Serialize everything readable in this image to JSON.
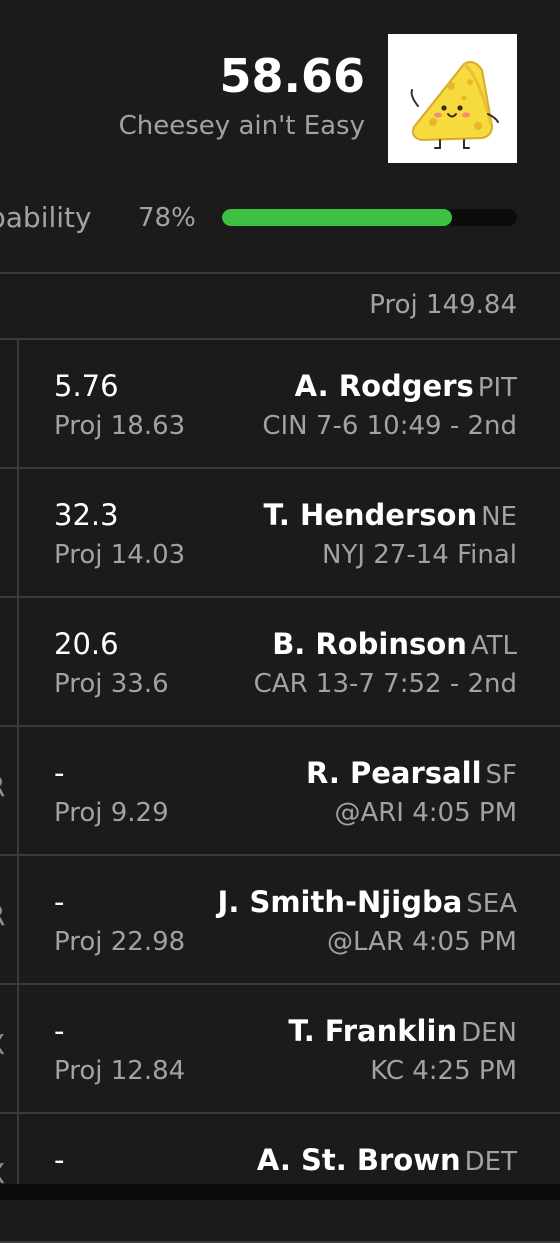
{
  "header": {
    "score": "58.66",
    "team_name": "Cheesey ain't Easy",
    "avatar_icon": "cheese-character-icon",
    "win_prob_label": "Win Probability",
    "win_prob_label_visible": "bability",
    "win_prob_value": "78%",
    "win_prob_fraction": 0.78,
    "win_prob_color": "#3ec143"
  },
  "summary": {
    "proj_total": "Proj 149.84"
  },
  "players": [
    {
      "pos_fragment": "",
      "points": "5.76",
      "proj": "Proj 18.63",
      "name": "A. Rodgers",
      "team": "PIT",
      "game": "CIN 7-6 10:49 - 2nd"
    },
    {
      "pos_fragment": "",
      "points": "32.3",
      "proj": "Proj 14.03",
      "name": "T. Henderson",
      "team": "NE",
      "game": "NYJ 27-14 Final"
    },
    {
      "pos_fragment": "",
      "points": "20.6",
      "proj": "Proj 33.6",
      "name": "B. Robinson",
      "team": "ATL",
      "game": "CAR 13-7 7:52 - 2nd"
    },
    {
      "pos_fragment": "R",
      "points": "-",
      "proj": "Proj 9.29",
      "name": "R. Pearsall",
      "team": "SF",
      "game": "@ARI 4:05 PM"
    },
    {
      "pos_fragment": "R",
      "points": "-",
      "proj": "Proj 22.98",
      "name": "J. Smith-Njigba",
      "team": "SEA",
      "game": "@LAR 4:05 PM"
    },
    {
      "pos_fragment": "X",
      "points": "-",
      "proj": "Proj 12.84",
      "name": "T. Franklin",
      "team": "DEN",
      "game": "KC 4:25 PM"
    },
    {
      "pos_fragment": "X",
      "points": "-",
      "proj": "",
      "name": "A. St. Brown",
      "team": "DET",
      "game": ""
    }
  ]
}
